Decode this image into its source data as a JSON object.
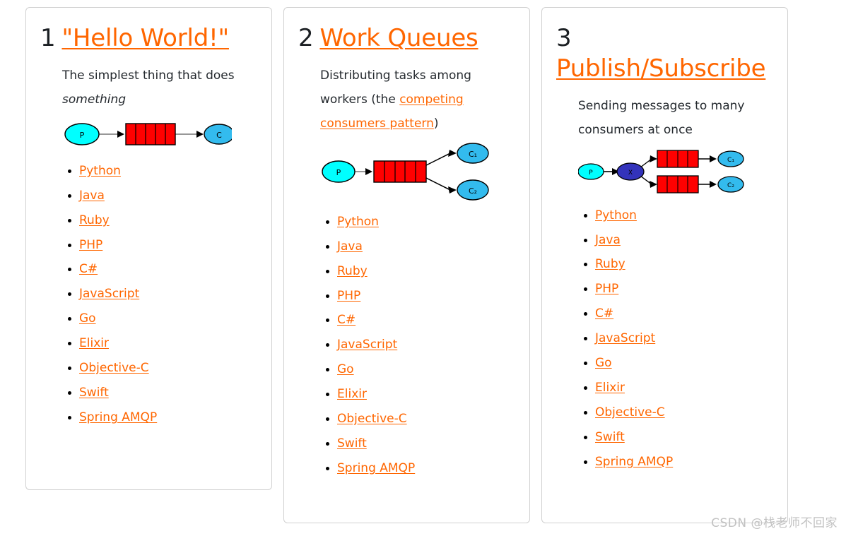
{
  "page": {
    "background_color": "#ffffff",
    "accent_color": "#ff6600",
    "text_color": "#24292e",
    "card_border_color": "#d0d0d0"
  },
  "watermark": {
    "text": "CSDN @栈老师不回家",
    "color": "#c2c2c2"
  },
  "cards": [
    {
      "number": "1",
      "title": "\"Hello World!\"",
      "desc_prefix": "The simplest thing that does ",
      "desc_em": "something",
      "desc_link": "",
      "desc_suffix": "",
      "diagram": {
        "type": "hello-world",
        "producer_label": "P",
        "consumer_labels": [
          "C"
        ],
        "queue_cells": 5,
        "producer_color": "#00ffff",
        "consumer_color": "#33bbee",
        "queue_color": "#ff0000",
        "exchange_color": "#3333bb"
      },
      "languages": [
        "Python",
        "Java",
        "Ruby",
        "PHP",
        "C#",
        "JavaScript",
        "Go",
        "Elixir",
        "Objective-C",
        "Swift",
        "Spring AMQP"
      ]
    },
    {
      "number": "2",
      "title": "Work Queues",
      "desc_prefix": "Distributing tasks among workers (the ",
      "desc_em": "",
      "desc_link": "competing consumers pattern",
      "desc_suffix": ")",
      "diagram": {
        "type": "work-queues",
        "producer_label": "P",
        "consumer_labels": [
          "C₁",
          "C₂"
        ],
        "queue_cells": 5,
        "producer_color": "#00ffff",
        "consumer_color": "#33bbee",
        "queue_color": "#ff0000",
        "exchange_color": "#3333bb"
      },
      "languages": [
        "Python",
        "Java",
        "Ruby",
        "PHP",
        "C#",
        "JavaScript",
        "Go",
        "Elixir",
        "Objective-C",
        "Swift",
        "Spring AMQP"
      ]
    },
    {
      "number": "3",
      "title": "Publish/Subscribe",
      "desc_prefix": "Sending messages to many consumers at once",
      "desc_em": "",
      "desc_link": "",
      "desc_suffix": "",
      "diagram": {
        "type": "publish-subscribe",
        "producer_label": "P",
        "exchange_label": "X",
        "consumer_labels": [
          "C₁",
          "C₂"
        ],
        "queue_cells": 4,
        "producer_color": "#00ffff",
        "consumer_color": "#33bbee",
        "queue_color": "#ff0000",
        "exchange_color": "#3333bb"
      },
      "languages": [
        "Python",
        "Java",
        "Ruby",
        "PHP",
        "C#",
        "JavaScript",
        "Go",
        "Elixir",
        "Objective-C",
        "Swift",
        "Spring AMQP"
      ]
    }
  ]
}
